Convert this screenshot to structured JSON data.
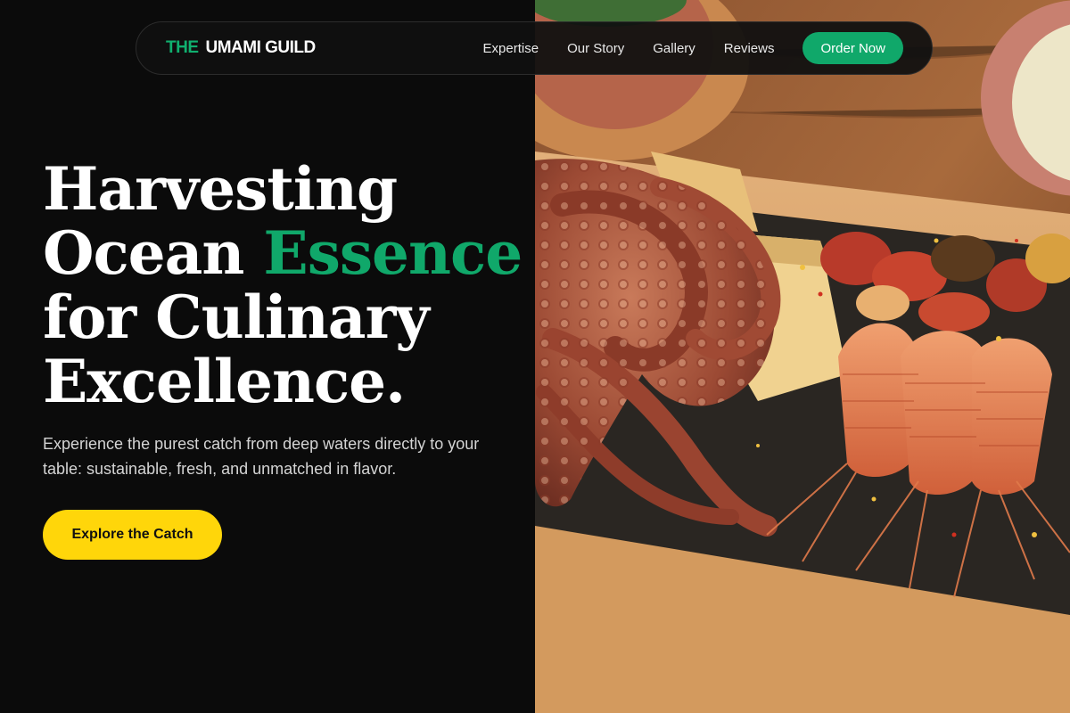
{
  "nav": {
    "brand_prefix": "THE",
    "brand_name": "UMAMI GUILD",
    "links": [
      "Expertise",
      "Our Story",
      "Gallery",
      "Reviews"
    ],
    "order_label": "Order Now"
  },
  "hero": {
    "headline_line1": "Harvesting",
    "headline_line2_a": "Ocean ",
    "headline_line2_accent": "Essence",
    "headline_line3": "for Culinary",
    "headline_line4": "Excellence.",
    "subtext": "Experience the purest catch from deep waters directly to your table: sustainable, fresh, and unmatched in flavor.",
    "cta_label": "Explore the Catch",
    "image_icon": "seafood-platter-photo"
  },
  "colors": {
    "background": "#0b0b0b",
    "accent_green": "#10a86a",
    "cta_yellow": "#ffd60a",
    "text_white": "#ffffff"
  }
}
